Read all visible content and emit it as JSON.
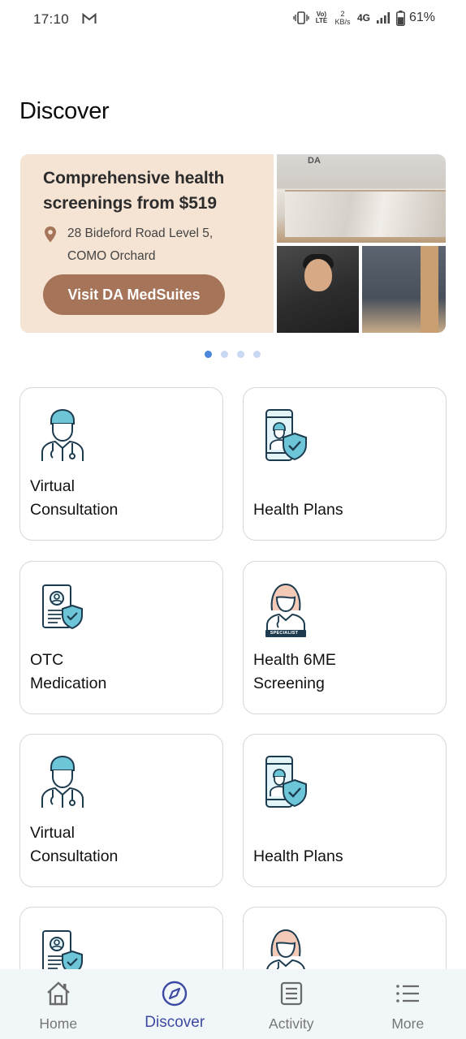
{
  "status_bar": {
    "time": "17:10",
    "volte_top": "Vo)",
    "volte_bottom": "LTE",
    "speed_value": "2",
    "speed_unit": "KB/s",
    "network": "4G",
    "battery_percent": "61%",
    "icons": [
      "gmail-icon",
      "vibrate-icon",
      "signal-icon",
      "battery-icon"
    ]
  },
  "page": {
    "title": "Discover"
  },
  "banner": {
    "headline": "Comprehensive health screenings from $519",
    "address_line1": "28 Bideford Road Level 5,",
    "address_line2": "COMO Orchard",
    "cta_label": "Visit DA MedSuites",
    "photo_logo": "DA",
    "background_color": "#f5e3d3",
    "cta_color": "#a57459",
    "page_indicator": {
      "count": 4,
      "active_index": 0
    }
  },
  "cards": [
    {
      "label": "Virtual\nConsultation",
      "icon": "doctor-icon"
    },
    {
      "label": "Health Plans",
      "icon": "phone-doctor-shield-icon"
    },
    {
      "label": "OTC\nMedication",
      "icon": "id-card-shield-icon"
    },
    {
      "label": "Health 6ME\nScreening",
      "icon": "specialist-icon",
      "icon_caption": "SPECIALIST"
    },
    {
      "label": "Virtual\nConsultation",
      "icon": "doctor-icon"
    },
    {
      "label": "Health Plans",
      "icon": "phone-doctor-shield-icon"
    },
    {
      "label": "",
      "icon": "id-card-shield-icon"
    },
    {
      "label": "",
      "icon": "specialist-icon"
    }
  ],
  "bottom_nav": {
    "items": [
      {
        "label": "Home",
        "icon": "home-icon"
      },
      {
        "label": "Discover",
        "icon": "compass-icon",
        "active": true
      },
      {
        "label": "Activity",
        "icon": "list-icon"
      },
      {
        "label": "More",
        "icon": "menu-icon"
      }
    ],
    "active_color": "#3d4aa1"
  }
}
